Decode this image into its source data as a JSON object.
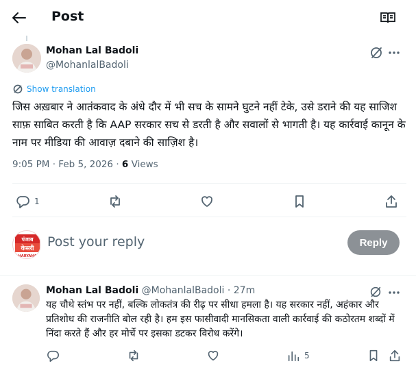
{
  "header": {
    "title": "Post"
  },
  "post": {
    "author_name": "Mohan Lal Badoli",
    "author_handle": "@MohanlalBadoli",
    "show_translation": "Show translation",
    "text": "जिस अख़बार ने आतंकवाद के अंधे दौर में भी सच के सामने घुटने नहीं टेके, उसे डराने की यह साजिश साफ़ साबित करती है कि AAP सरकार सच से डरती है और सवालों से भागती है। यह कार्रवाई कानून के नाम पर मीडिया की आवाज़ दबाने की साज़िश है।",
    "time": "9:05 PM",
    "date": "Feb 5, 2026",
    "views_count": "6",
    "views_label": "Views",
    "reply_count": "1"
  },
  "reply_box": {
    "placeholder": "Post your reply",
    "button_label": "Reply",
    "avatar_text_top": "पंजाब",
    "avatar_text_mid": "केसरी",
    "avatar_text_bottom": "HARYANA"
  },
  "reply_tweet": {
    "author_name": "Mohan Lal Badoli",
    "author_handle": "@MohanlalBadoli",
    "separator": "·",
    "time_ago": "27m",
    "text": "यह चौथे स्तंभ पर नहीं, बल्कि लोकतंत्र की रीढ़ पर सीधा हमला है। यह सरकार नहीं, अहंकार और प्रतिशोध की राजनीति बोल रही है। हम इस फासीवादी मानसिकता वाली कार्रवाई की कठोरतम शब्दों में निंदा करते हैं और हर मोर्चे पर इसका डटकर विरोध करेंगे।",
    "views_count": "5"
  },
  "colors": {
    "link": "#1d9bf0",
    "muted": "#536471",
    "reply_button": "#8c9196",
    "divider": "#eff3f4"
  }
}
